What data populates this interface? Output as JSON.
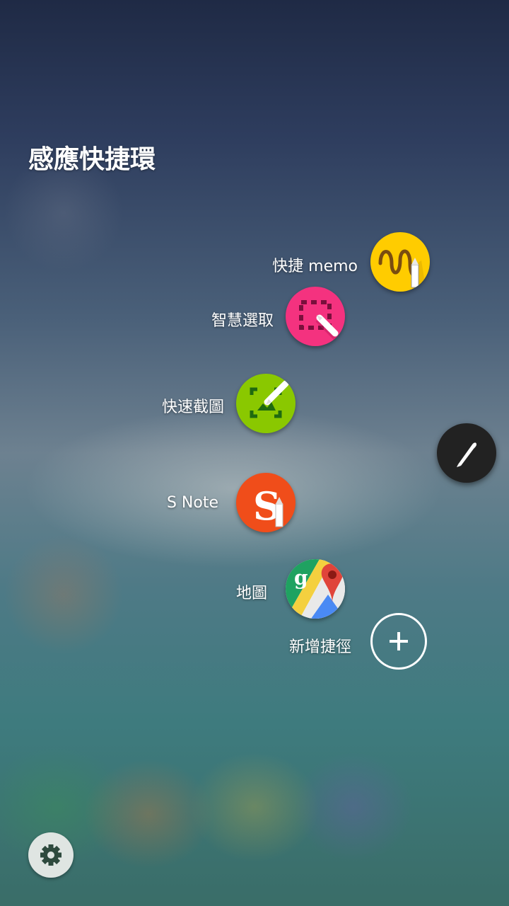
{
  "title": "感應快捷環",
  "shortcuts": [
    {
      "label": "快捷 memo",
      "icon": "action-memo-icon",
      "color": "#ffcc00"
    },
    {
      "label": "智慧選取",
      "icon": "smart-select-icon",
      "color": "#f4327f"
    },
    {
      "label": "快速截圖",
      "icon": "screen-write-icon",
      "color": "#8ac800"
    },
    {
      "label": "S Note",
      "icon": "s-note-icon",
      "color": "#f04d1a"
    },
    {
      "label": "地圖",
      "icon": "google-maps-icon",
      "color": "#ffffff"
    }
  ],
  "add_shortcut": {
    "label": "新增捷徑",
    "icon": "plus-icon"
  },
  "pen_button": {
    "icon": "pen-icon"
  },
  "settings": {
    "icon": "gear-icon"
  }
}
